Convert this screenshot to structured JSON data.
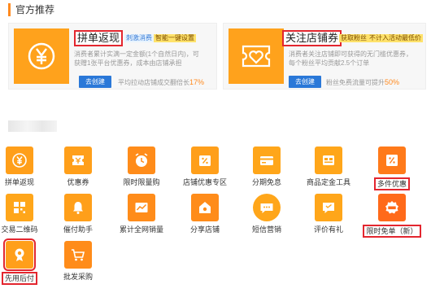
{
  "section_title": "官方推荐",
  "cards": [
    {
      "name": "拼单返现",
      "tags": [
        "刺激消费",
        "智能一键设置"
      ],
      "desc": [
        "消费者累计实满一定金额(1个自然日内)，可",
        "获赠1张平台优惠券，成本由店铺承担"
      ],
      "button": "去创建",
      "note": "平均拉动店铺成交翻倍长",
      "note_value": "17%",
      "colors": {
        "thumb": "#ffa21c"
      }
    },
    {
      "name": "关注店铺券",
      "tags": [
        "获取粉丝",
        "不计入活动最低价"
      ],
      "desc": [
        "消费者关注店铺即可获得的无门槛优惠券，",
        "每个粉丝平均贡献2.5个订单"
      ],
      "button": "去创建",
      "note": "粉丝免费流量可提升",
      "note_value": "50%",
      "colors": {
        "thumb": "#ffa21c"
      }
    }
  ],
  "tools": [
    {
      "label": "拼单返现",
      "icon": "yen-icon"
    },
    {
      "label": "优惠券",
      "icon": "coupon-icon"
    },
    {
      "label": "限时限量购",
      "icon": "alarm-icon"
    },
    {
      "label": "店铺优惠专区",
      "icon": "discount-tag-icon"
    },
    {
      "label": "分期免息",
      "icon": "card-icon"
    },
    {
      "label": "商品定金工具",
      "icon": "deposit-icon"
    },
    {
      "label": "多件优惠",
      "icon": "multi-discount-icon"
    },
    {
      "label": "交易二维码",
      "icon": "qrcode-icon"
    },
    {
      "label": "催付助手",
      "icon": "bell-icon"
    },
    {
      "label": "累计全网销量",
      "icon": "chart-icon"
    },
    {
      "label": "分享店铺",
      "icon": "share-store-icon"
    },
    {
      "label": "短信营销",
      "icon": "sms-icon"
    },
    {
      "label": "评价有礼",
      "icon": "review-gift-icon"
    },
    {
      "label": "限时免单（新）",
      "icon": "free-order-icon"
    },
    {
      "label": "先用后付",
      "icon": "pay-later-icon"
    },
    {
      "label": "批发采购",
      "icon": "cart-icon"
    }
  ],
  "colors": {
    "accent": "#ff8a1f",
    "icon_bg": "#ff9f1a",
    "button": "#2a78d8",
    "highlight_box": "#e3262f"
  }
}
